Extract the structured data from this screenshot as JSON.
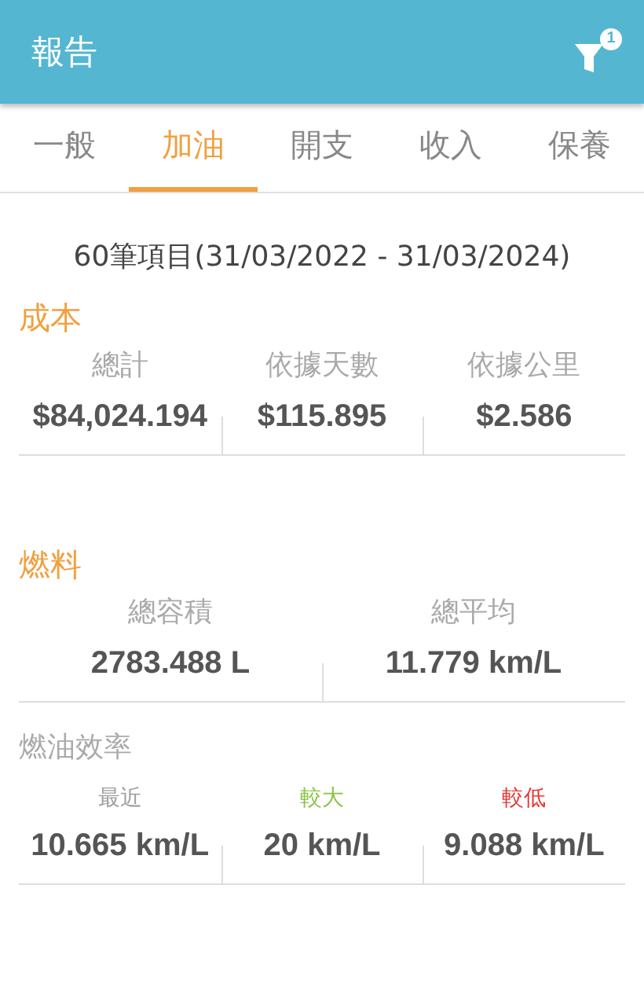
{
  "app_bar": {
    "title": "報告",
    "filter_badge": "1"
  },
  "tabs": [
    {
      "label": "一般",
      "selected": false
    },
    {
      "label": "加油",
      "selected": true
    },
    {
      "label": "開支",
      "selected": false
    },
    {
      "label": "收入",
      "selected": false
    },
    {
      "label": "保養",
      "selected": false
    }
  ],
  "summary": "60筆項目(31/03/2022 - 31/03/2024)",
  "sections": [
    {
      "title": "成本",
      "stats": [
        {
          "label": "總計",
          "value": "$84,024.194"
        },
        {
          "label": "依據天數",
          "value": "$115.895"
        },
        {
          "label": "依據公里",
          "value": "$2.586"
        }
      ]
    },
    {
      "title": "燃料",
      "stats": [
        {
          "label": "總容積",
          "value": "2783.488 L"
        },
        {
          "label": "總平均",
          "value": "11.779 km/L"
        }
      ]
    }
  ],
  "fuel_efficiency": {
    "title": "燃油效率",
    "stats": [
      {
        "label": "最近",
        "color": "#9e9e9e",
        "value": "10.665 km/L"
      },
      {
        "label": "較大",
        "color": "#8bc34a",
        "value": "20 km/L"
      },
      {
        "label": "較低",
        "color": "#e53935",
        "value": "9.088 km/L"
      }
    ]
  }
}
